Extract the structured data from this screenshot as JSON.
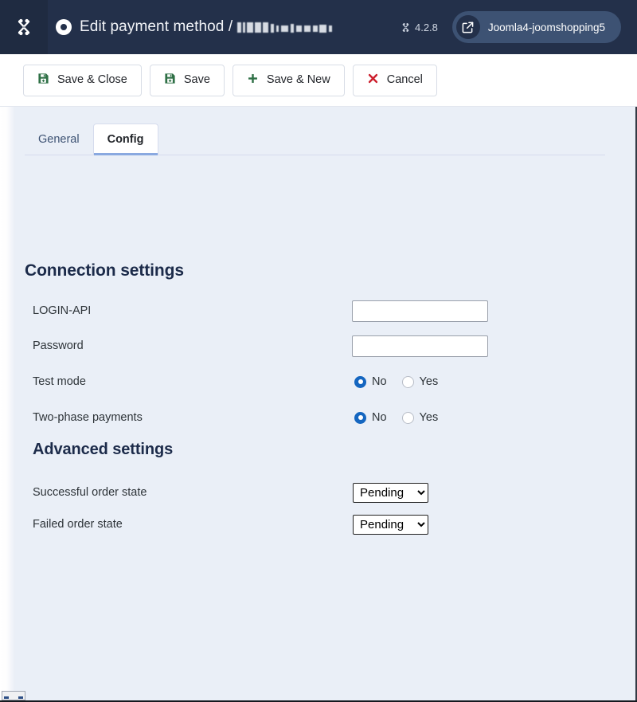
{
  "header": {
    "logo_icon": "joomla-logo-icon",
    "title_icon": "record-dot-icon",
    "title": "Edit payment method /",
    "redacted_label": "",
    "version_icon": "joomla-mini-icon",
    "version": "4.2.8",
    "site_link_icon": "external-link-icon",
    "site_name": "Joomla4-joomshopping5",
    "colors": {
      "bar": "#23304a",
      "logo_box": "#1f2b41",
      "pill": "#3d5273"
    }
  },
  "toolbar": {
    "buttons": [
      {
        "id": "save-close",
        "label": "Save & Close",
        "icon": "save-floppy-icon",
        "icon_color": "#2f7046"
      },
      {
        "id": "save",
        "label": "Save",
        "icon": "save-floppy-icon",
        "icon_color": "#2f7046"
      },
      {
        "id": "save-new",
        "label": "Save & New",
        "icon": "plus-icon",
        "icon_color": "#2f7046"
      },
      {
        "id": "cancel",
        "label": "Cancel",
        "icon": "close-x-icon",
        "icon_color": "#cc1f2d"
      }
    ]
  },
  "tabs": [
    {
      "id": "general",
      "label": "General",
      "active": false
    },
    {
      "id": "config",
      "label": "Config",
      "active": true
    }
  ],
  "sections": {
    "connection": {
      "title": "Connection settings",
      "fields": [
        {
          "id": "login-api",
          "label": "LOGIN-API",
          "type": "text",
          "value": "",
          "placeholder": ""
        },
        {
          "id": "password",
          "label": "Password",
          "type": "text",
          "value": "",
          "placeholder": ""
        },
        {
          "id": "test-mode",
          "label": "Test mode",
          "type": "radio",
          "selected": "No",
          "options": [
            {
              "label": "No",
              "selected": true
            },
            {
              "label": "Yes",
              "selected": false
            }
          ]
        },
        {
          "id": "two-phase-payments",
          "label": "Two-phase payments",
          "type": "radio",
          "selected": "No",
          "options": [
            {
              "label": "No",
              "selected": true
            },
            {
              "label": "Yes",
              "selected": false
            }
          ]
        }
      ]
    },
    "advanced": {
      "title": "Advanced settings",
      "fields": [
        {
          "id": "successful-order-state",
          "label": "Successful order state",
          "type": "select",
          "value": "Pending"
        },
        {
          "id": "failed-order-state",
          "label": "Failed order state",
          "type": "select",
          "value": "Pending"
        }
      ]
    }
  },
  "colors": {
    "content_bg": "#eaeff7",
    "accent_blue": "#1566c0",
    "tab_underline": "#8aa9e0",
    "heading": "#1c2b4a"
  }
}
